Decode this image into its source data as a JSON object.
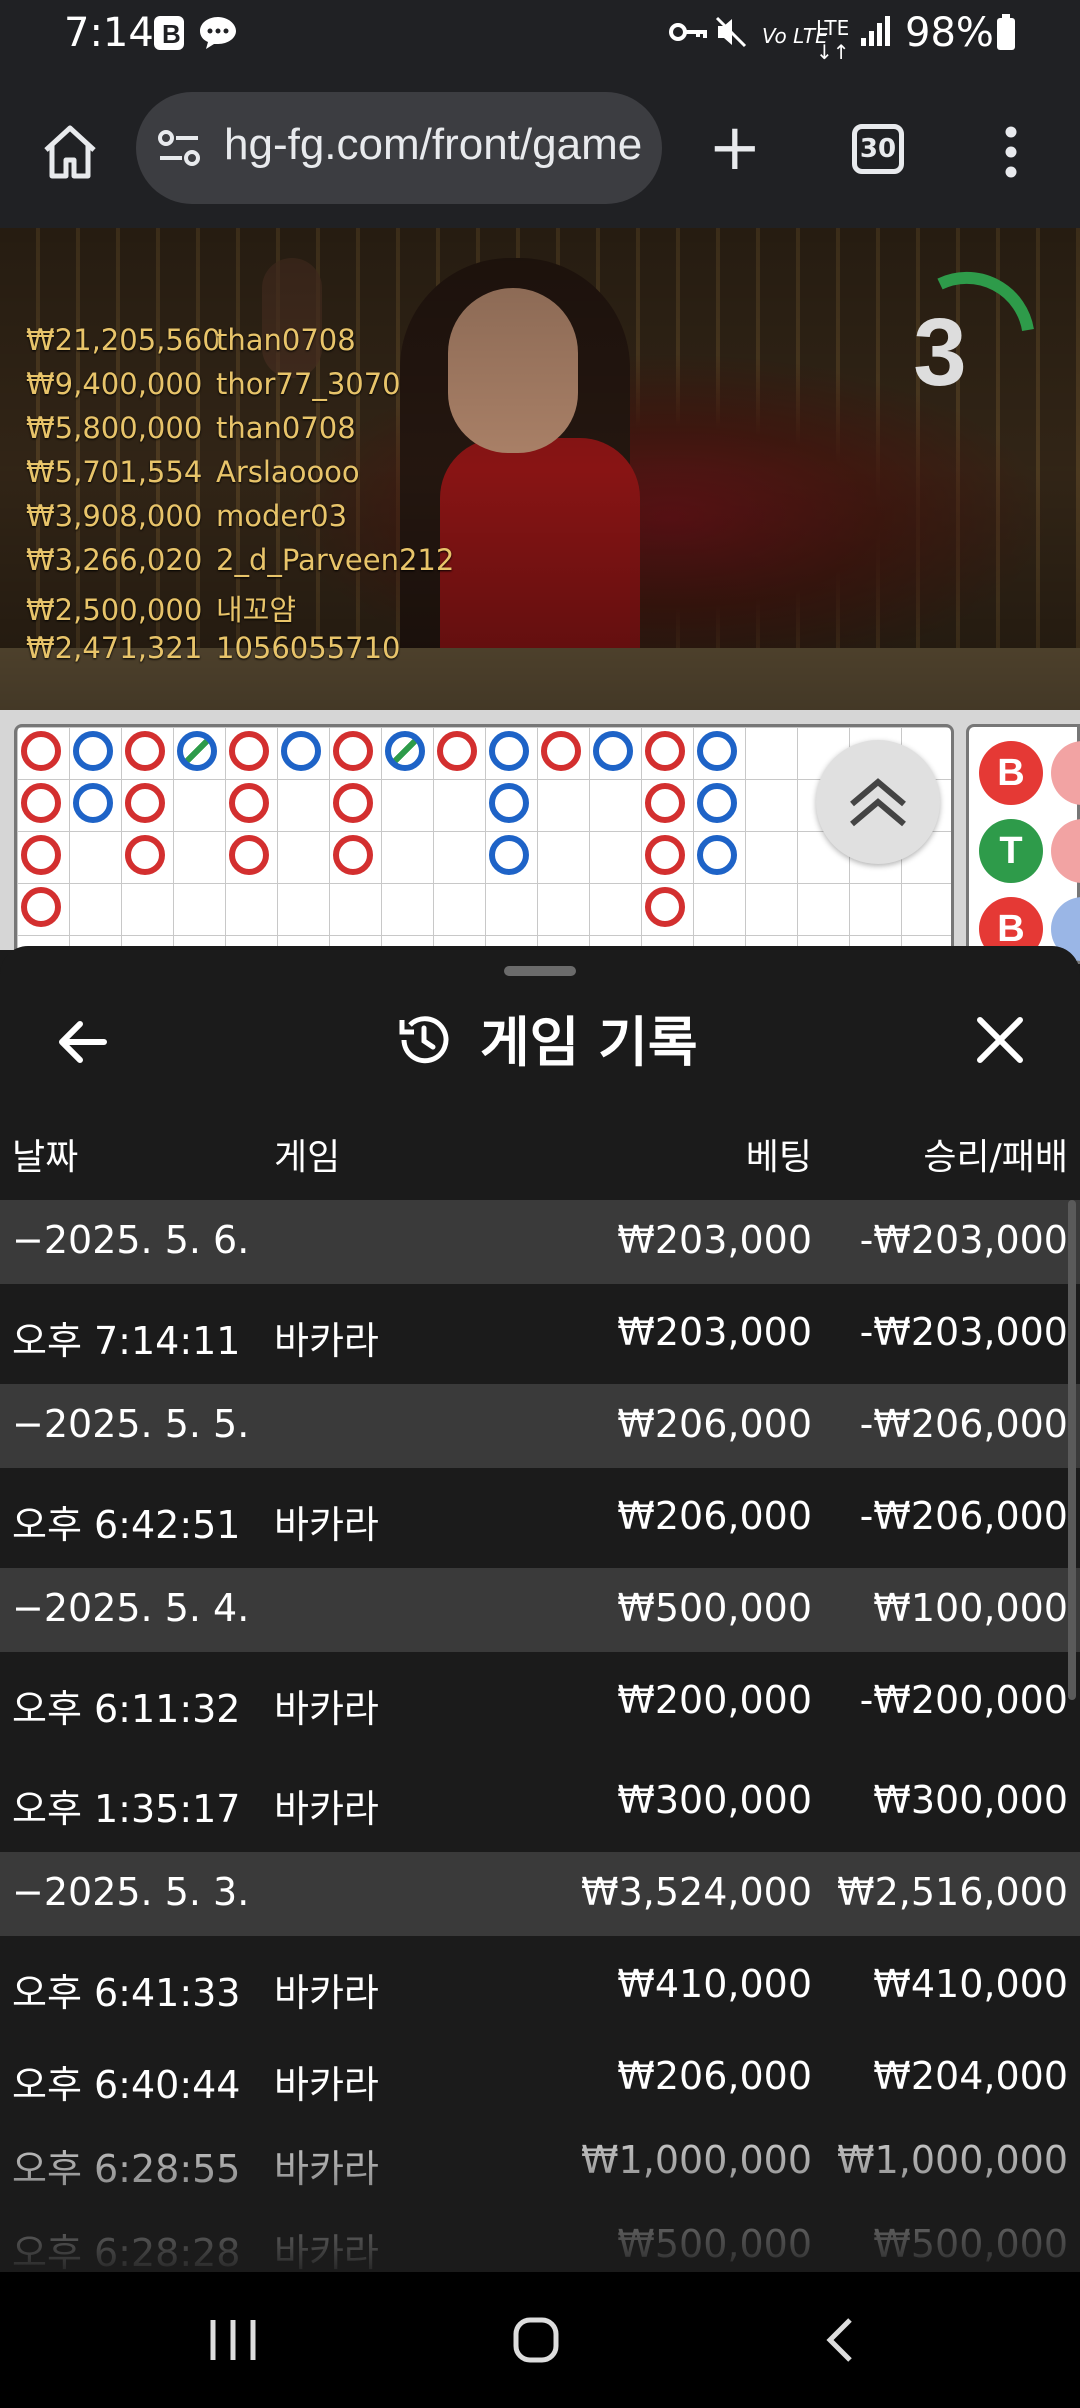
{
  "status_bar": {
    "time": "7:14",
    "battery": "98%"
  },
  "browser": {
    "url": "hg-fg.com/front/game",
    "tab_count": "30"
  },
  "video": {
    "countdown": "3",
    "winners": [
      {
        "amount": "₩21,205,560",
        "user": "than0708"
      },
      {
        "amount": "₩9,400,000",
        "user": "thor77_3070"
      },
      {
        "amount": "₩5,800,000",
        "user": "than0708"
      },
      {
        "amount": "₩5,701,554",
        "user": "Arslaoooo"
      },
      {
        "amount": "₩3,908,000",
        "user": "moder03"
      },
      {
        "amount": "₩3,266,020",
        "user": "2_d_Parveen212"
      },
      {
        "amount": "₩2,500,000",
        "user": "내꼬얌"
      },
      {
        "amount": "₩2,471,321",
        "user": "1056055710"
      }
    ]
  },
  "roadmap": {
    "side_tokens": [
      {
        "label": "B",
        "color": "#e53935"
      },
      {
        "label": "T",
        "color": "#2e9b4a"
      },
      {
        "label": "B",
        "color": "#e53935"
      }
    ]
  },
  "panel": {
    "title": "게임 기록",
    "headers": {
      "date": "날짜",
      "game": "게임",
      "bet": "베팅",
      "winloss": "승리/패배"
    },
    "rows": [
      {
        "type": "group",
        "date": "−2025. 5. 6.",
        "game": "",
        "bet": "₩203,000",
        "winloss": "-₩203,000"
      },
      {
        "type": "item",
        "date": "오후 7:14:11",
        "game": "바카라",
        "bet": "₩203,000",
        "winloss": "-₩203,000"
      },
      {
        "type": "group",
        "date": "−2025. 5. 5.",
        "game": "",
        "bet": "₩206,000",
        "winloss": "-₩206,000"
      },
      {
        "type": "item",
        "date": "오후 6:42:51",
        "game": "바카라",
        "bet": "₩206,000",
        "winloss": "-₩206,000"
      },
      {
        "type": "group",
        "date": "−2025. 5. 4.",
        "game": "",
        "bet": "₩500,000",
        "winloss": "₩100,000"
      },
      {
        "type": "item",
        "date": "오후 6:11:32",
        "game": "바카라",
        "bet": "₩200,000",
        "winloss": "-₩200,000"
      },
      {
        "type": "item",
        "date": "오후 1:35:17",
        "game": "바카라",
        "bet": "₩300,000",
        "winloss": "₩300,000"
      },
      {
        "type": "group",
        "date": "−2025. 5. 3.",
        "game": "",
        "bet": "₩3,524,000",
        "winloss": "₩2,516,000"
      },
      {
        "type": "item",
        "date": "오후 6:41:33",
        "game": "바카라",
        "bet": "₩410,000",
        "winloss": "₩410,000"
      },
      {
        "type": "item",
        "date": "오후 6:40:44",
        "game": "바카라",
        "bet": "₩206,000",
        "winloss": "₩204,000"
      },
      {
        "type": "item",
        "date": "오후 6:28:55",
        "game": "바카라",
        "bet": "₩1,000,000",
        "winloss": "₩1,000,000"
      },
      {
        "type": "item",
        "date": "오후 6:28:28",
        "game": "바카라",
        "bet": "₩500,000",
        "winloss": "₩500,000"
      }
    ]
  }
}
